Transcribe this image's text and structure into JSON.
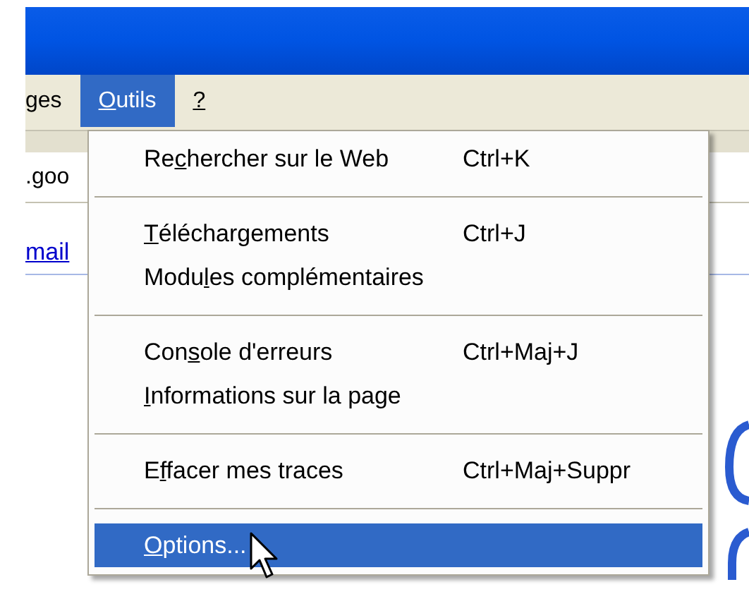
{
  "menu_bar": [
    {
      "label": {
        "before": "ges"
      },
      "selected": false
    },
    {
      "label": {
        "key": "O",
        "after": "utils"
      },
      "selected": true
    },
    {
      "label": {
        "key": "?"
      },
      "selected": false
    }
  ],
  "address_bar": {
    "value": ".goo"
  },
  "page": {
    "link": "mail"
  },
  "menu": {
    "items": [
      {
        "kind": "item",
        "label": {
          "before": "Re",
          "key": "c",
          "after": "hercher sur le Web"
        },
        "shortcut": "Ctrl+K",
        "selected": false
      },
      {
        "kind": "separator"
      },
      {
        "kind": "item",
        "label": {
          "key": "T",
          "after": "éléchargements"
        },
        "shortcut": "Ctrl+J",
        "selected": false
      },
      {
        "kind": "item",
        "label": {
          "before": "Modu",
          "key": "l",
          "after": "es complémentaires"
        },
        "selected": false
      },
      {
        "kind": "separator"
      },
      {
        "kind": "item",
        "label": {
          "before": "Con",
          "key": "s",
          "after": "ole d'erreurs"
        },
        "shortcut": "Ctrl+Maj+J",
        "selected": false
      },
      {
        "kind": "item",
        "label": {
          "key": "I",
          "after": "nformations sur la page"
        },
        "selected": false
      },
      {
        "kind": "separator"
      },
      {
        "kind": "item",
        "label": {
          "before": "E",
          "key": "f",
          "after": "facer mes traces"
        },
        "shortcut": "Ctrl+Maj+Suppr",
        "selected": false
      },
      {
        "kind": "separator"
      },
      {
        "kind": "item",
        "label": {
          "key": "O",
          "after": "ptions..."
        },
        "selected": true
      }
    ]
  }
}
